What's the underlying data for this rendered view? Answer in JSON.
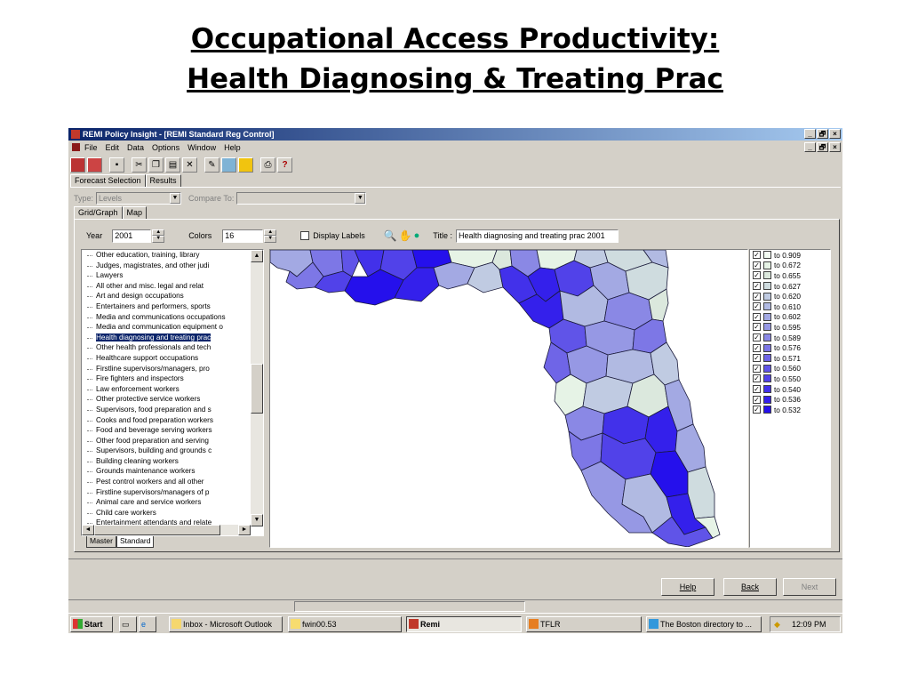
{
  "slide": {
    "title_line1": "Occupational Access Productivity:",
    "title_line2": "Health Diagnosing & Treating Prac"
  },
  "window": {
    "title": "REMI Policy Insight - [REMI Standard Reg Control]",
    "minimize": "_",
    "restore": "🗗",
    "close": "×"
  },
  "menu": [
    "File",
    "Edit",
    "Data",
    "Options",
    "Window",
    "Help"
  ],
  "tabs": {
    "forecast": "Forecast Selection",
    "results": "Results"
  },
  "type_row": {
    "type_label": "Type:",
    "type_value": "Levels",
    "compare_label": "Compare To:",
    "compare_value": ""
  },
  "inner_tabs": {
    "grid": "Grid/Graph",
    "map": "Map"
  },
  "controls": {
    "year_label": "Year",
    "year_value": "2001",
    "colors_label": "Colors",
    "colors_value": "16",
    "display_labels": "Display Labels",
    "title_label": "Title :",
    "title_value": "Health diagnosing and treating prac  2001"
  },
  "occupations": [
    "Other education, training, library",
    "Judges, magistrates, and other judi",
    "Lawyers",
    "All other and misc. legal and relat",
    "Art and design occupations",
    "Entertainers and performers, sports",
    "Media and communications occupations",
    "Media and communication equipment o",
    "Health diagnosing and treating prac",
    "Other health professionals and tech",
    "Healthcare support occupations",
    "Firstline supervisors/managers, pro",
    "Fire fighters and inspectors",
    "Law enforcement workers",
    "Other protective service workers",
    "Supervisors, food preparation and s",
    "Cooks and food preparation workers",
    "Food and beverage serving workers",
    "Other food preparation and serving",
    "Supervisors, building and grounds c",
    "Building cleaning workers",
    "Grounds maintenance workers",
    "Pest control workers and all other",
    "Firstline supervisors/managers of p",
    "Animal care and service workers",
    "Child care workers",
    "Entertainment attendants and relate"
  ],
  "selected_index": 8,
  "sheet_tabs": {
    "master": "Master",
    "standard": "Standard"
  },
  "legend": [
    {
      "label": "to 0.909",
      "color": "#f2fbf2"
    },
    {
      "label": "to 0.672",
      "color": "#e6f3e6"
    },
    {
      "label": "to 0.655",
      "color": "#dbe8dd"
    },
    {
      "label": "to 0.627",
      "color": "#cfdcdf"
    },
    {
      "label": "to 0.620",
      "color": "#c0cbe2"
    },
    {
      "label": "to 0.610",
      "color": "#b1bae2"
    },
    {
      "label": "to 0.602",
      "color": "#a3a9e3"
    },
    {
      "label": "to 0.595",
      "color": "#9698e4"
    },
    {
      "label": "to 0.589",
      "color": "#8a88e5"
    },
    {
      "label": "to 0.576",
      "color": "#7d77e6"
    },
    {
      "label": "to 0.571",
      "color": "#6f65e7"
    },
    {
      "label": "to 0.560",
      "color": "#6054e8"
    },
    {
      "label": "to 0.550",
      "color": "#5142e9"
    },
    {
      "label": "to 0.540",
      "color": "#4231ea"
    },
    {
      "label": "to 0.536",
      "color": "#3420eb"
    },
    {
      "label": "to 0.532",
      "color": "#2510ec"
    }
  ],
  "buttons": {
    "help": "Help",
    "back": "Back",
    "next": "Next"
  },
  "taskbar": {
    "start": "Start",
    "tasks": [
      "Inbox - Microsoft Outlook",
      "fwin00.53",
      "Remi",
      "TFLR",
      "The Boston directory to ..."
    ],
    "clock": "12:09 PM"
  },
  "colors": {
    "titlebar": "#0a246a",
    "chrome": "#d4d0c8",
    "selection": "#0a246a"
  }
}
